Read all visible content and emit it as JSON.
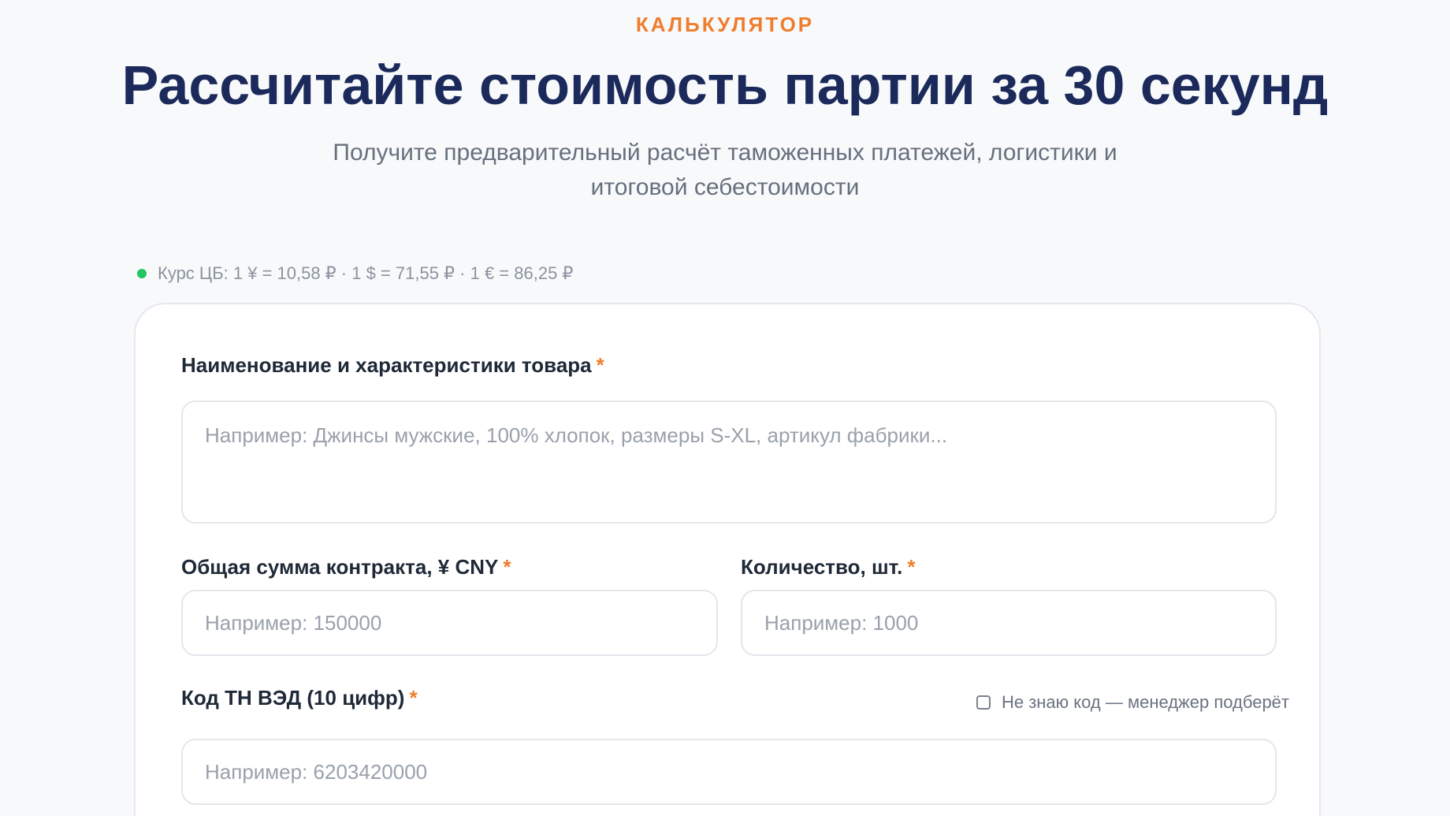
{
  "hero": {
    "eyebrow": "КАЛЬКУЛЯТОР",
    "title": "Рассчитайте стоимость партии за 30 секунд",
    "subtitle": "Получите предварительный расчёт таможенных платежей, логистики и итоговой себестоимости"
  },
  "rates": {
    "text": "Курс ЦБ: 1 ¥ = 10,58 ₽ · 1 $ = 71,55 ₽ · 1 € = 86,25 ₽",
    "status_color": "#22c55e"
  },
  "form": {
    "product": {
      "label": "Наименование и характеристики товара",
      "required_mark": "*",
      "placeholder": "Например: Джинсы мужские, 100% хлопок, размеры S-XL, артикул фабрики..."
    },
    "contract_sum": {
      "label": "Общая сумма контракта, ¥ CNY",
      "required_mark": "*",
      "placeholder": "Например: 150000"
    },
    "quantity": {
      "label": "Количество, шт.",
      "required_mark": "*",
      "placeholder": "Например: 1000"
    },
    "hs_code": {
      "label": "Код ТН ВЭД (10 цифр)",
      "required_mark": "*",
      "placeholder": "Например: 6203420000",
      "unknown_code_label": "Не знаю код — менеджер подберёт",
      "unknown_code_checked": false
    }
  },
  "colors": {
    "accent": "#ef7d2d",
    "title": "#1b2a5b"
  }
}
